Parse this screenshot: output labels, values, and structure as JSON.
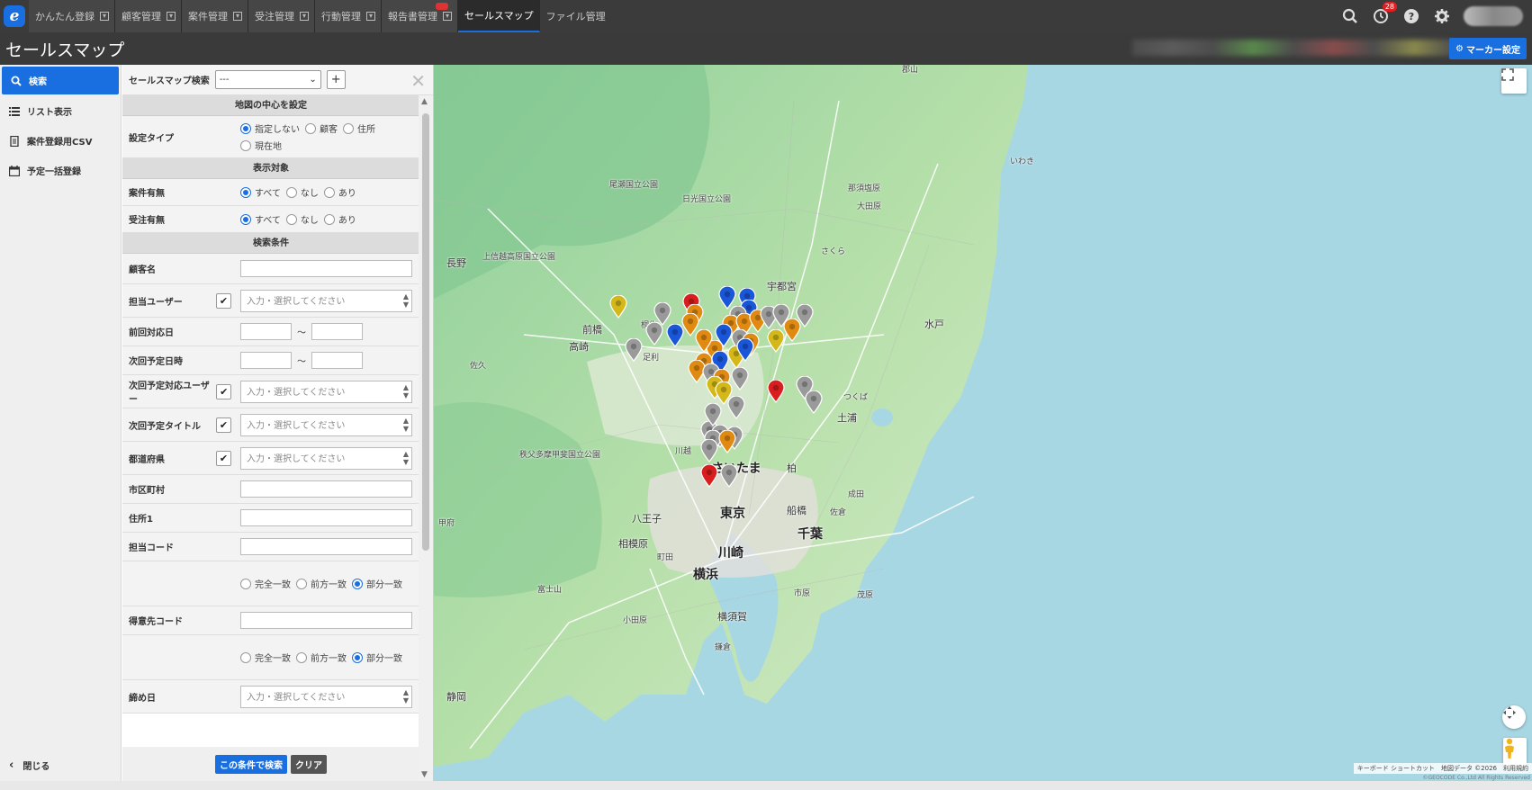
{
  "nav": {
    "tabs": [
      {
        "label": "かんたん登録"
      },
      {
        "label": "顧客管理"
      },
      {
        "label": "案件管理"
      },
      {
        "label": "受注管理"
      },
      {
        "label": "行動管理"
      },
      {
        "label": "報告書管理"
      },
      {
        "label": "セールスマップ"
      },
      {
        "label": "ファイル管理"
      }
    ],
    "notification_count": "28",
    "icons": [
      "search-icon",
      "clock-icon",
      "help-icon",
      "gear-icon"
    ]
  },
  "title": "セールスマップ",
  "marker_settings_label": "マーカー設定",
  "leftmenu": {
    "items": [
      {
        "label": "検索",
        "icon": "search-icon"
      },
      {
        "label": "リスト表示",
        "icon": "list-icon"
      },
      {
        "label": "案件登録用CSV",
        "icon": "csv-icon"
      },
      {
        "label": "予定一括登録",
        "icon": "calendar-icon"
      }
    ],
    "close_label": "閉じる"
  },
  "panel": {
    "search_label": "セールスマップ検索",
    "search_select_value": "---",
    "sections": {
      "center": "地図の中心を設定",
      "target": "表示対象",
      "conditions": "検索条件"
    },
    "setting_type": {
      "label": "設定タイプ",
      "options": [
        "指定しない",
        "顧客",
        "住所",
        "現在地"
      ]
    },
    "anken": {
      "label": "案件有無",
      "options": [
        "すべて",
        "なし",
        "あり"
      ]
    },
    "juchu": {
      "label": "受注有無",
      "options": [
        "すべて",
        "なし",
        "あり"
      ]
    },
    "fields": {
      "customer_name": "顧客名",
      "tanto_user": "担当ユーザー",
      "last_date": "前回対応日",
      "next_datetime": "次回予定日時",
      "next_user": "次回予定対応ユーザー",
      "next_title": "次回予定タイトル",
      "prefecture": "都道府県",
      "city": "市区町村",
      "address1": "住所1",
      "tanto_code": "担当コード",
      "tokui_code": "得意先コード",
      "shime": "締め日"
    },
    "placeholder": "入力・選択してください",
    "tilde": "～",
    "match_options": [
      "完全一致",
      "前方一致",
      "部分一致"
    ],
    "search_button": "この条件で検索",
    "clear_button": "クリア"
  },
  "map": {
    "places_big": [
      "東京",
      "横浜",
      "千葉",
      "川崎",
      "さいたま"
    ],
    "places_mid": [
      "前橋",
      "高崎",
      "宇都宮",
      "水戸",
      "八王子",
      "相模原",
      "船橋",
      "横須賀",
      "静岡",
      "長野",
      "柏",
      "土浦"
    ],
    "places_small": [
      "郡山",
      "いわき",
      "日光国立公園",
      "尾瀬国立公園",
      "上信越高原国立公園",
      "秩父多摩甲斐国立公園",
      "富士山",
      "那須塩原",
      "大田原",
      "さくら",
      "つくば",
      "小田原",
      "甲府",
      "佐久",
      "桐生",
      "足利",
      "川越",
      "町田",
      "鎌倉",
      "成田",
      "佐倉",
      "市原",
      "茂原"
    ],
    "attribution": "キーボード ショートカット　地図データ ©2026　利用規約",
    "copyright": "©GEOCODE Co.,Ltd All Rights Reserved"
  },
  "colors": {
    "accent": "#1a6fe0",
    "pin_blue": "#1a56d8",
    "pin_orange": "#e08a12",
    "pin_gray": "#9a9a9a",
    "pin_yellow": "#d4b81a",
    "pin_red": "#d81e1e"
  }
}
